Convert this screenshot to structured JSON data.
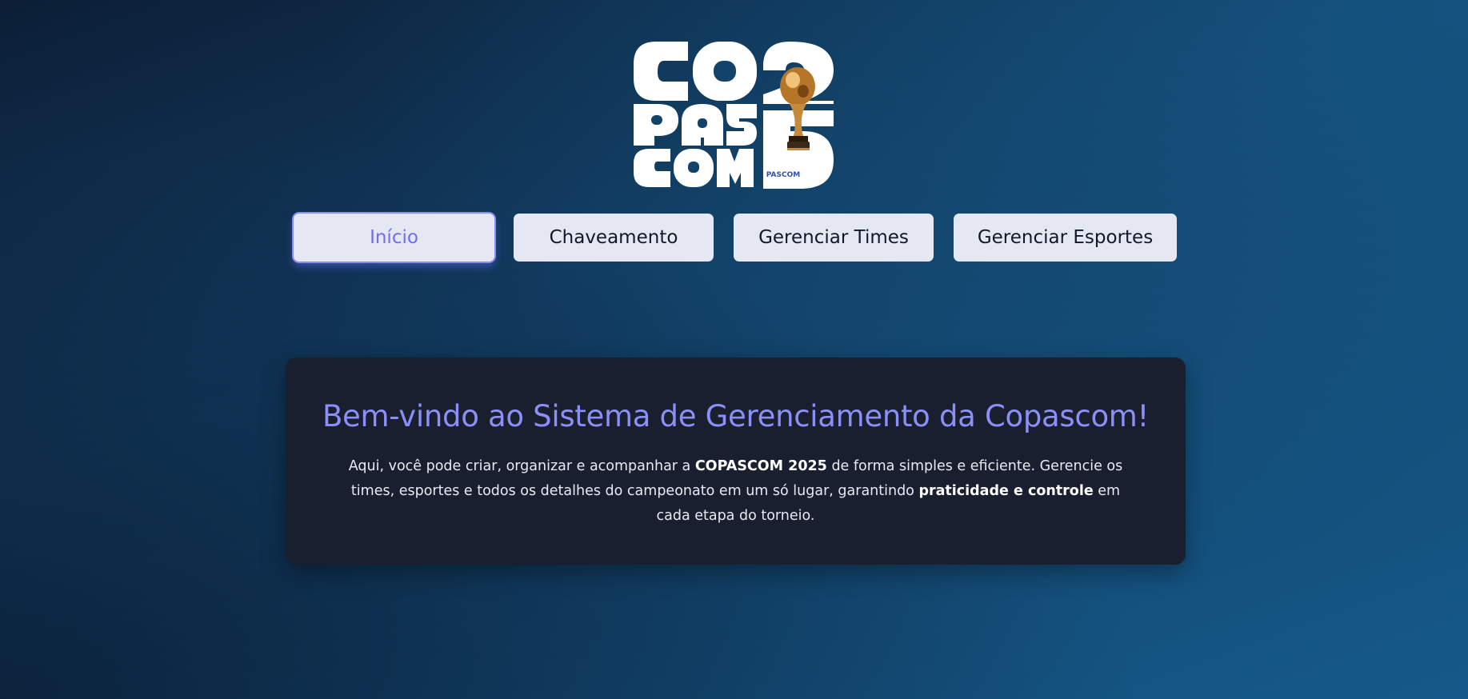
{
  "logo": {
    "alt": "COPASCOM 2025",
    "lines": [
      "CO",
      "PAS",
      "COM"
    ],
    "year_digits": [
      "2",
      "5"
    ],
    "badge": "PASCOM",
    "trophy_icon": "trophy-icon"
  },
  "nav": {
    "items": [
      {
        "label": "Início",
        "active": true
      },
      {
        "label": "Chaveamento",
        "active": false
      },
      {
        "label": "Gerenciar Times",
        "active": false
      },
      {
        "label": "Gerenciar Esportes",
        "active": false
      }
    ]
  },
  "welcome": {
    "title": "Bem-vindo ao Sistema de Gerenciamento da Copascom!",
    "text_1": "Aqui, você pode criar, organizar e acompanhar a ",
    "text_bold_1": "COPASCOM 2025",
    "text_2": " de forma simples e eficiente. Gerencie os times, esportes e todos os detalhes do campeonato em um só lugar, garantindo ",
    "text_bold_2": "praticidade e controle",
    "text_3": " em cada etapa do torneio."
  },
  "colors": {
    "accent": "#8b8ff8",
    "active_nav_text": "#6f6ef2",
    "nav_bg": "#e5e8f3",
    "card_bg": "#1a1f30",
    "logo_badge": "#2f4fb5"
  }
}
